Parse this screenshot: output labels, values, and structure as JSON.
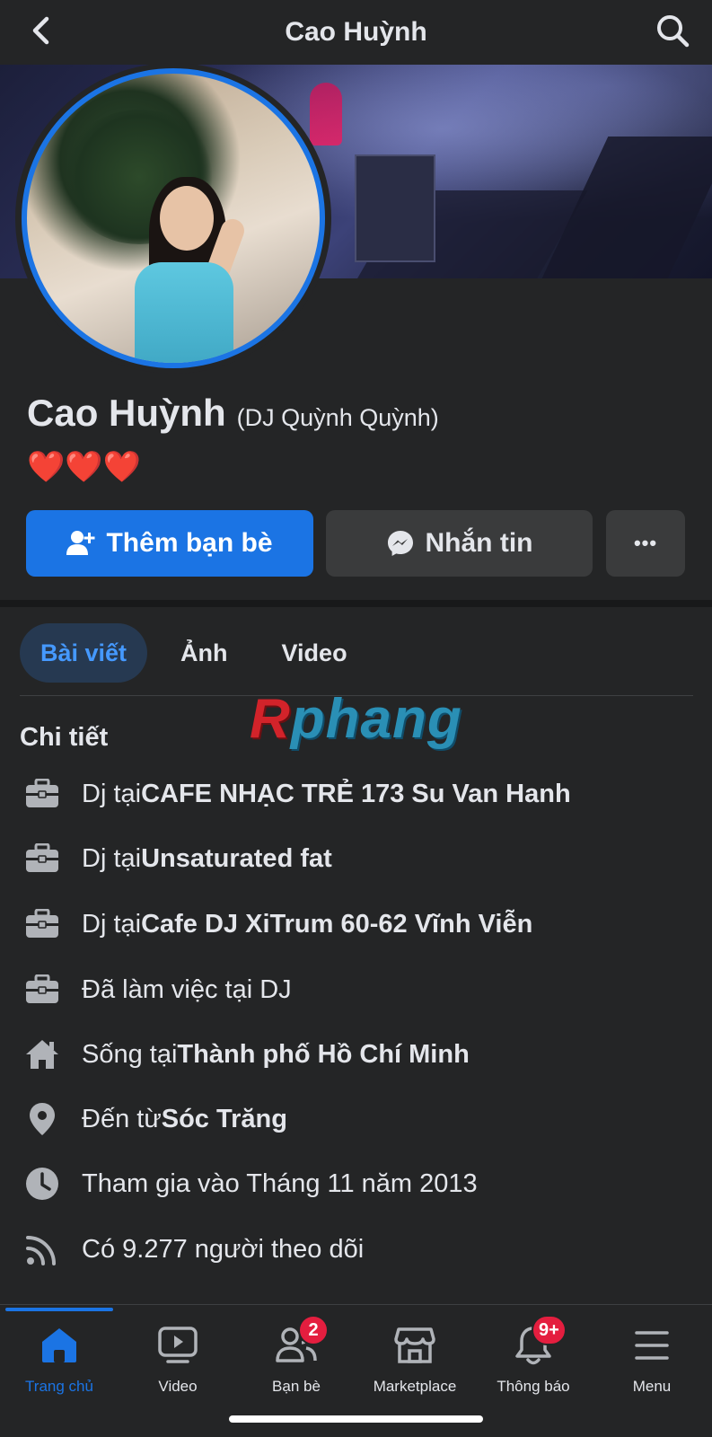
{
  "header": {
    "title": "Cao Huỳnh",
    "back_icon": "chevron-left-icon",
    "search_icon": "search-icon"
  },
  "profile": {
    "name": "Cao Huỳnh",
    "alternate_name": "(DJ Quỳnh Quỳnh)",
    "bio": "❤️❤️❤️",
    "accent_color": "#1b74e4"
  },
  "actions": {
    "add_friend_label": "Thêm bạn bè",
    "message_label": "Nhắn tin",
    "more_label": "•••"
  },
  "tabs": [
    {
      "label": "Bài viết",
      "active": true
    },
    {
      "label": "Ảnh",
      "active": false
    },
    {
      "label": "Video",
      "active": false
    }
  ],
  "watermark": {
    "first_letter": "R",
    "rest": "phang"
  },
  "details": {
    "title": "Chi tiết",
    "items": [
      {
        "icon": "briefcase-icon",
        "prefix": "Dj tại ",
        "bold": "CAFE NHẠC TRẺ 173 Su Van Hanh"
      },
      {
        "icon": "briefcase-icon",
        "prefix": "Dj tại ",
        "bold": "Unsaturated fat"
      },
      {
        "icon": "briefcase-icon",
        "prefix": "Dj tại ",
        "bold": "Cafe DJ XiTrum 60-62 Vĩnh Viễn"
      },
      {
        "icon": "briefcase-icon",
        "prefix": "Đã làm việc tại DJ",
        "bold": ""
      },
      {
        "icon": "home-icon",
        "prefix": "Sống tại ",
        "bold": "Thành phố Hồ Chí Minh"
      },
      {
        "icon": "location-pin-icon",
        "prefix": "Đến từ ",
        "bold": "Sóc Trăng"
      },
      {
        "icon": "clock-icon",
        "prefix": "Tham gia vào Tháng 11 năm 2013",
        "bold": ""
      },
      {
        "icon": "rss-icon",
        "prefix": "Có 9.277 người theo dõi",
        "bold": ""
      }
    ]
  },
  "bottom_nav": {
    "items": [
      {
        "label": "Trang chủ",
        "icon": "home-icon",
        "active": true,
        "badge": ""
      },
      {
        "label": "Video",
        "icon": "video-icon",
        "active": false,
        "badge": ""
      },
      {
        "label": "Bạn bè",
        "icon": "friends-icon",
        "active": false,
        "badge": "2"
      },
      {
        "label": "Marketplace",
        "icon": "marketplace-icon",
        "active": false,
        "badge": ""
      },
      {
        "label": "Thông báo",
        "icon": "bell-icon",
        "active": false,
        "badge": "9+"
      },
      {
        "label": "Menu",
        "icon": "menu-icon",
        "active": false,
        "badge": ""
      }
    ]
  }
}
